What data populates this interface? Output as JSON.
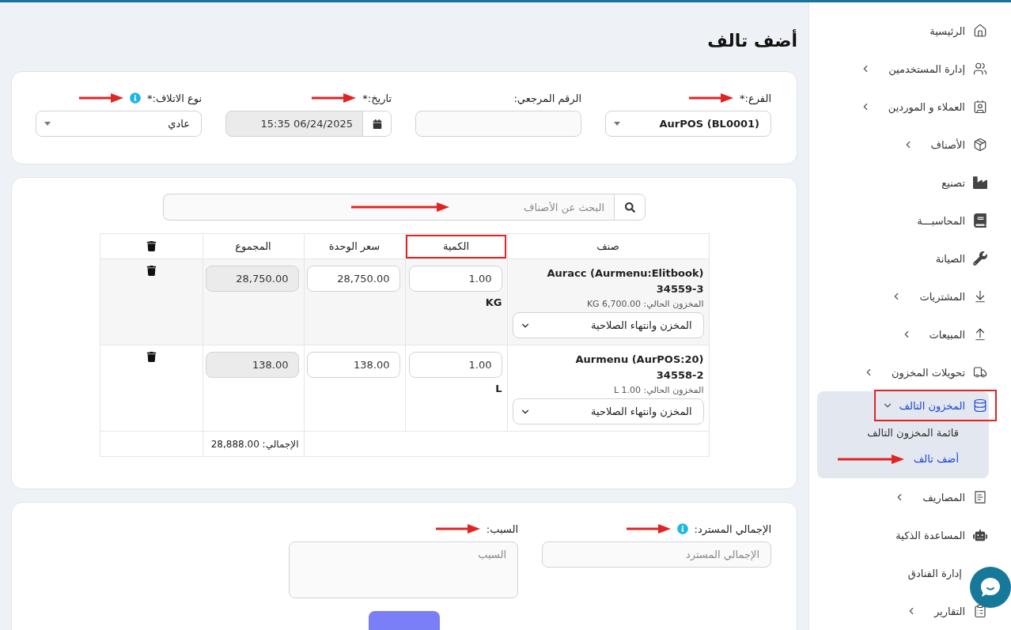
{
  "page": {
    "title": "أضف تالف"
  },
  "header_form": {
    "fields": [
      {
        "kind": "select",
        "label": "الفرع:*",
        "value": "AurPOS (BL0001)",
        "arrow": true
      },
      {
        "kind": "text",
        "label": "الرقم المرجعي:"
      },
      {
        "kind": "date",
        "label": "تاريخ:*",
        "value": "15:35 06/24/2025",
        "arrow": true
      },
      {
        "kind": "select",
        "label": "نوع الاتلاف:*",
        "value": "عادي",
        "arrow": true,
        "info": true
      }
    ]
  },
  "search": {
    "placeholder": "البحث عن الأصناف",
    "arrow": true
  },
  "table": {
    "columns": [
      {
        "kind": "text",
        "label": "صنف",
        "highlighted": false
      },
      {
        "kind": "text",
        "label": "الكمية",
        "highlighted": true
      },
      {
        "kind": "text",
        "label": "سعر الوحدة",
        "highlighted": false
      },
      {
        "kind": "text",
        "label": "المجموع",
        "highlighted": false
      },
      {
        "kind": "delete",
        "highlighted": false
      }
    ],
    "rows": [
      {
        "name": "Auracc (Aurmenu:Elitbook)",
        "code": "34559-3",
        "stock": "المخزون الحالي: KG 6,700.00",
        "location": "المخزن وانتهاء الصلاحية",
        "quantity": "1.00",
        "unit": "KG",
        "unit_price": "28,750.00",
        "total": "28,750.00"
      },
      {
        "name": "Aurmenu (AurPOS:20)",
        "code": "34558-2",
        "stock": "المخزون الحالي: L 1.00",
        "location": "المخزن وانتهاء الصلاحية",
        "quantity": "1.00",
        "unit": "L",
        "unit_price": "138.00",
        "total": "138.00"
      }
    ],
    "grand_total": "الإجمالي: 28,888.00"
  },
  "footer_form": {
    "fields": [
      {
        "kind": "text",
        "label": "الإجمالي المسترد:",
        "placeholder": "الإجمالي المسترد",
        "arrow": true,
        "info": true
      },
      {
        "kind": "textarea",
        "label": "السبب:",
        "placeholder": "السبب",
        "arrow": true
      }
    ]
  },
  "sidebar": {
    "items": [
      {
        "label": "الرئيسية",
        "has_children": false,
        "expanded": false,
        "highlighted": false
      },
      {
        "label": "إدارة المستخدمين",
        "has_children": true,
        "expanded": false,
        "highlighted": false
      },
      {
        "label": "العملاء و الموردين",
        "has_children": true,
        "expanded": false,
        "highlighted": false
      },
      {
        "label": "الأصناف",
        "has_children": true,
        "expanded": false,
        "highlighted": false
      },
      {
        "label": "تصنيع",
        "has_children": false,
        "expanded": false,
        "highlighted": false
      },
      {
        "label": "المحاسبـــة",
        "has_children": false,
        "expanded": false,
        "highlighted": false
      },
      {
        "label": "الصيانة",
        "has_children": false,
        "expanded": false,
        "highlighted": false
      },
      {
        "label": "المشتريات",
        "has_children": true,
        "expanded": false,
        "highlighted": false
      },
      {
        "label": "المبيعات",
        "has_children": true,
        "expanded": false,
        "highlighted": false
      },
      {
        "label": "تحويلات المخزون",
        "has_children": true,
        "expanded": false,
        "highlighted": false
      },
      {
        "label": "المخزون التالف",
        "has_children": true,
        "expanded": true,
        "highlighted": true,
        "children": [
          {
            "label": "قائمة المخزون التالف",
            "selected": false,
            "arrow": false
          },
          {
            "label": "أضف تالف",
            "selected": true,
            "arrow": true
          }
        ]
      },
      {
        "label": "المصاريف",
        "has_children": true,
        "expanded": false,
        "highlighted": false
      },
      {
        "label": "المساعدة الذكية",
        "has_children": false,
        "expanded": false,
        "highlighted": false
      },
      {
        "label": "إدارة الفنادق",
        "has_children": false,
        "expanded": false,
        "highlighted": false
      },
      {
        "label": "التقارير",
        "has_children": true,
        "expanded": false,
        "highlighted": false
      }
    ]
  }
}
